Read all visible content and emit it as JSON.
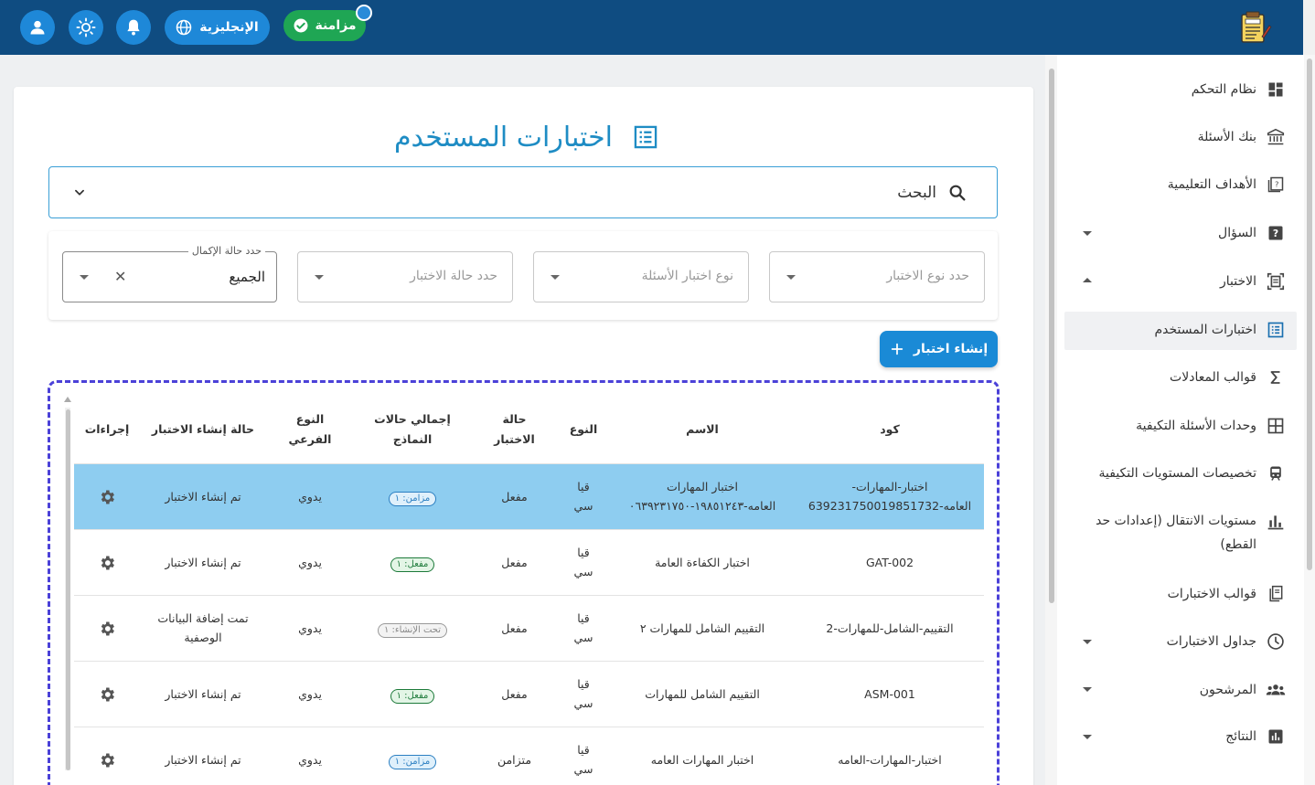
{
  "topbar": {
    "language_label": "الإنجليزية",
    "sync_label": "مزامنة",
    "icons": [
      "user-icon",
      "sun-icon",
      "bell-icon",
      "globe-icon",
      "check-circle-icon",
      "exam-logo-icon"
    ]
  },
  "sidebar": {
    "items": [
      {
        "label": "نظام التحكم",
        "icon": "dashboard-icon"
      },
      {
        "label": "بنك الأسئلة",
        "icon": "bank-icon"
      },
      {
        "label": "الأهداف التعليمية",
        "icon": "book-question-icon"
      },
      {
        "label": "السؤال",
        "icon": "question-icon"
      },
      {
        "label": "الاختبار",
        "icon": "exam-scan-icon"
      },
      {
        "label": "اختبارات المستخدم",
        "icon": "list-icon"
      },
      {
        "label": "قوالب المعادلات",
        "icon": "sigma-icon"
      },
      {
        "label": "وحدات الأسئلة التكيفية",
        "icon": "grid-icon"
      },
      {
        "label": "تخصيصات المستويات التكيفية",
        "icon": "train-icon"
      },
      {
        "label": "مستويات الانتقال (إعدادات حد",
        "label2": "القطع)",
        "icon": "bar-chart-icon"
      },
      {
        "label": "قوالب الاختبارات",
        "icon": "template-icon"
      },
      {
        "label": "جداول الاختبارات",
        "icon": "clock-icon"
      },
      {
        "label": "المرشحون",
        "icon": "people-icon"
      },
      {
        "label": "النتائج",
        "icon": "results-icon"
      }
    ]
  },
  "main": {
    "title": "اختبارات المستخدم",
    "search_label": "البحث",
    "filters": {
      "exam_type_placeholder": "حدد نوع الاختبار",
      "question_type_placeholder": "نوع اختبار الأسئلة",
      "exam_state_placeholder": "حدد حالة الاختبار",
      "completion_legend": "حدد حالة الإكمال",
      "completion_value": "الجميع"
    },
    "create_button": "إنشاء اختبار",
    "table": {
      "headers": {
        "code": "كود",
        "name": "الاسم",
        "type": "النوع",
        "state_1": "حالة",
        "state_2": "الاختبار",
        "models_1": "إجمالي حالات",
        "models_2": "النماذج",
        "sub_1": "النوع",
        "sub_2": "الفرعي",
        "create_state": "حالة إنشاء الاختبار",
        "actions": "إجراءات"
      },
      "rows": [
        {
          "code_1": "اختبار-المهارات-",
          "code_2": "العامه-639231750019851732",
          "name_1": "اختبار المهارات",
          "name_2": "العامه-١٩٨٥١٢٤٣-٠٦٣٩٢٣١٧٥٠",
          "type_1": "قيا",
          "type_2": "سي",
          "state": "مفعل",
          "chip": "مزامن: ١",
          "chip_kind": "sync",
          "sub": "يدوي",
          "create_1": "تم إنشاء الاختبار",
          "create_2": ""
        },
        {
          "code_1": "GAT-002",
          "code_2": "",
          "name_1": "اختبار الكفاءة العامة",
          "name_2": "",
          "type_1": "قيا",
          "type_2": "سي",
          "state": "مفعل",
          "chip": "مفعل: ١",
          "chip_kind": "active",
          "sub": "يدوي",
          "create_1": "تم إنشاء الاختبار",
          "create_2": ""
        },
        {
          "code_1": "التقييم-الشامل-للمهارات-2",
          "code_2": "",
          "name_1": "التقييم الشامل للمهارات ٢",
          "name_2": "",
          "type_1": "قيا",
          "type_2": "سي",
          "state": "مفعل",
          "chip": "تحت الإنشاء: ١",
          "chip_kind": "create",
          "sub": "يدوي",
          "create_1": "تمت إضافة البيانات",
          "create_2": "الوصفية"
        },
        {
          "code_1": "ASM-001",
          "code_2": "",
          "name_1": "التقييم الشامل للمهارات",
          "name_2": "",
          "type_1": "قيا",
          "type_2": "سي",
          "state": "مفعل",
          "chip": "مفعل: ١",
          "chip_kind": "active",
          "sub": "يدوي",
          "create_1": "تم إنشاء الاختبار",
          "create_2": ""
        },
        {
          "code_1": "اختبار-المهارات-العامه",
          "code_2": "",
          "name_1": "اختبار المهارات العامه",
          "name_2": "",
          "type_1": "قيا",
          "type_2": "سي",
          "state": "متزامن",
          "chip": "مزامن: ١",
          "chip_kind": "sync",
          "sub": "يدوي",
          "create_1": "تم إنشاء الاختبار",
          "create_2": ""
        }
      ]
    }
  },
  "colors": {
    "topbar": "#0f4c81",
    "accent": "#1e88d8",
    "sync_green": "#1fa654",
    "title_blue": "#1e8cc4",
    "row_highlight": "#8ecdf0",
    "dashed_border": "#4b41d8"
  }
}
